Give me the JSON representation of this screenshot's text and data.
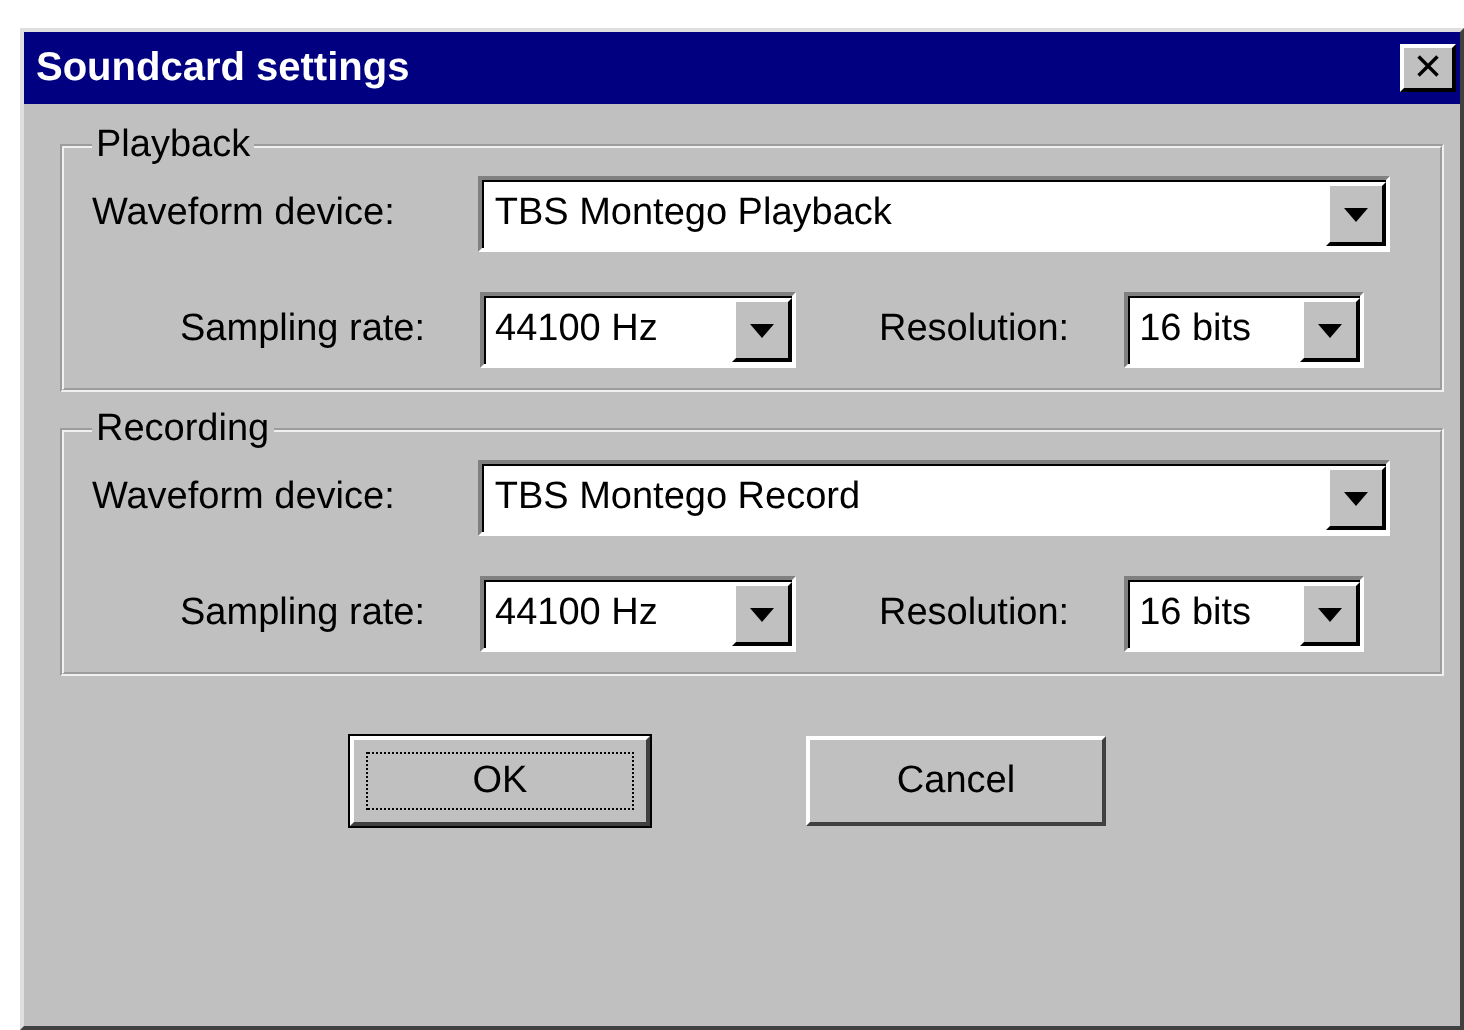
{
  "window": {
    "title": "Soundcard settings",
    "close": "×"
  },
  "groups": [
    {
      "title": "Playback",
      "device": {
        "label": "Waveform device:",
        "value": "TBS Montego Playback"
      },
      "rate": {
        "label": "Sampling rate:",
        "value": "44100 Hz"
      },
      "resolution": {
        "label": "Resolution:",
        "value": "16 bits"
      }
    },
    {
      "title": "Recording",
      "device": {
        "label": "Waveform device:",
        "value": "TBS Montego Record"
      },
      "rate": {
        "label": "Sampling rate:",
        "value": "44100 Hz"
      },
      "resolution": {
        "label": "Resolution:",
        "value": "16 bits"
      }
    }
  ],
  "buttons": [
    {
      "label": "OK",
      "default": true
    },
    {
      "label": "Cancel",
      "default": false
    }
  ]
}
